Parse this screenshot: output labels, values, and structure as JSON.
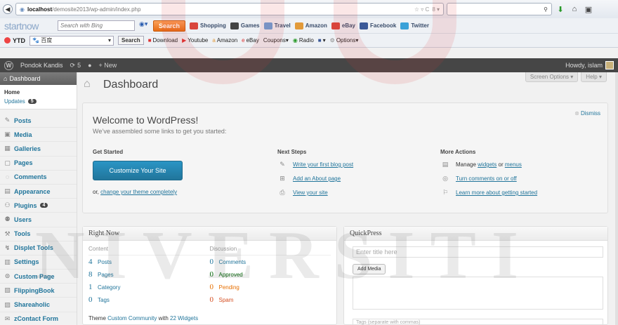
{
  "browser": {
    "url_host": "localhost",
    "url_path": "/demosite2013/wp-admin/index.php",
    "url_tools": "☆ ▿ C",
    "search_engine": "8 ▾",
    "search_tool_icon": "search-icon"
  },
  "startnow": {
    "logo": "startnow",
    "search_placeholder": "Search with Bing",
    "search_button": "Search",
    "links": [
      "Shopping",
      "Games",
      "Travel",
      "Amazon",
      "eBay",
      "Facebook",
      "Twitter"
    ],
    "link_colors": [
      "#d9463c",
      "#444444",
      "#6aa0d8",
      "#e29a3a",
      "#d9463c",
      "#3b5998",
      "#3aa1d8"
    ]
  },
  "ytd": {
    "label": "YTD",
    "select_value": "百度",
    "search_button": "Search",
    "items": [
      "Download",
      "Youtube",
      "Amazon",
      "eBay",
      "Coupons▾",
      "Radio",
      "Options▾"
    ]
  },
  "adminbar": {
    "site_name": "Pondok Kandis",
    "updates_count": "5",
    "new_label": "+ New",
    "howdy": "Howdy, islam"
  },
  "sidebar": {
    "dashboard_label": "Dashboard",
    "home_label": "Home",
    "updates_label": "Updates",
    "updates_badge": "5",
    "items": [
      {
        "label": "Posts",
        "icon": "pin-icon"
      },
      {
        "label": "Media",
        "icon": "media-icon"
      },
      {
        "label": "Galleries",
        "icon": "gallery-icon"
      },
      {
        "label": "Pages",
        "icon": "pages-icon"
      },
      {
        "label": "Comments",
        "icon": "comment-icon"
      },
      {
        "label": "Appearance",
        "icon": "appearance-icon"
      },
      {
        "label": "Plugins",
        "icon": "plugin-icon",
        "badge": "4"
      },
      {
        "label": "Users",
        "icon": "users-icon"
      },
      {
        "label": "Tools",
        "icon": "tools-icon"
      },
      {
        "label": "Displet Tools",
        "icon": "displet-icon"
      },
      {
        "label": "Settings",
        "icon": "settings-icon"
      },
      {
        "label": "Custom Page",
        "icon": "custom-page-icon"
      },
      {
        "label": "FlippingBook",
        "icon": "flippingbook-icon"
      },
      {
        "label": "Shareaholic",
        "icon": "shareaholic-icon"
      },
      {
        "label": "zContact Form",
        "icon": "contact-icon"
      }
    ]
  },
  "main": {
    "screen_options": "Screen Options ▾",
    "help": "Help ▾",
    "title": "Dashboard",
    "welcome": {
      "heading": "Welcome to WordPress!",
      "subheading": "We’ve assembled some links to get you started:",
      "dismiss": "Dismiss",
      "get_started": "Get Started",
      "customize_button": "Customize Your Site",
      "or_text": "or, ",
      "change_theme_link": "change your theme completely",
      "next_steps": "Next Steps",
      "next_items": [
        "Write your first blog post",
        "Add an About page",
        "View your site"
      ],
      "more_actions": "More Actions",
      "manage_text": "Manage ",
      "widgets_link": "widgets",
      "or_word": " or ",
      "menus_link": "menus",
      "comments_link": "Turn comments on or off",
      "learn_link": "Learn more about getting started"
    },
    "right_now": {
      "title": "Right Now",
      "content_head": "Content",
      "discussion_head": "Discussion",
      "content": [
        {
          "num": "4",
          "label": "Posts"
        },
        {
          "num": "8",
          "label": "Pages"
        },
        {
          "num": "1",
          "label": "Category"
        },
        {
          "num": "0",
          "label": "Tags"
        }
      ],
      "discussion": [
        {
          "num": "0",
          "label": "Comments",
          "cls": ""
        },
        {
          "num": "0",
          "label": "Approved",
          "cls": "approved"
        },
        {
          "num": "0",
          "label": "Pending",
          "cls": "pending"
        },
        {
          "num": "0",
          "label": "Spam",
          "cls": "spam"
        }
      ],
      "theme_prefix": "Theme ",
      "theme_name": "Custom Community",
      "theme_with": " with ",
      "widgets_link": "22 Widgets"
    },
    "quickpress": {
      "title": "QuickPress",
      "title_placeholder": "Enter title here",
      "add_media": "Add Media",
      "tags_placeholder": "Tags (separate with commas)"
    }
  },
  "watermark": {
    "word": "NIVERSITI"
  }
}
